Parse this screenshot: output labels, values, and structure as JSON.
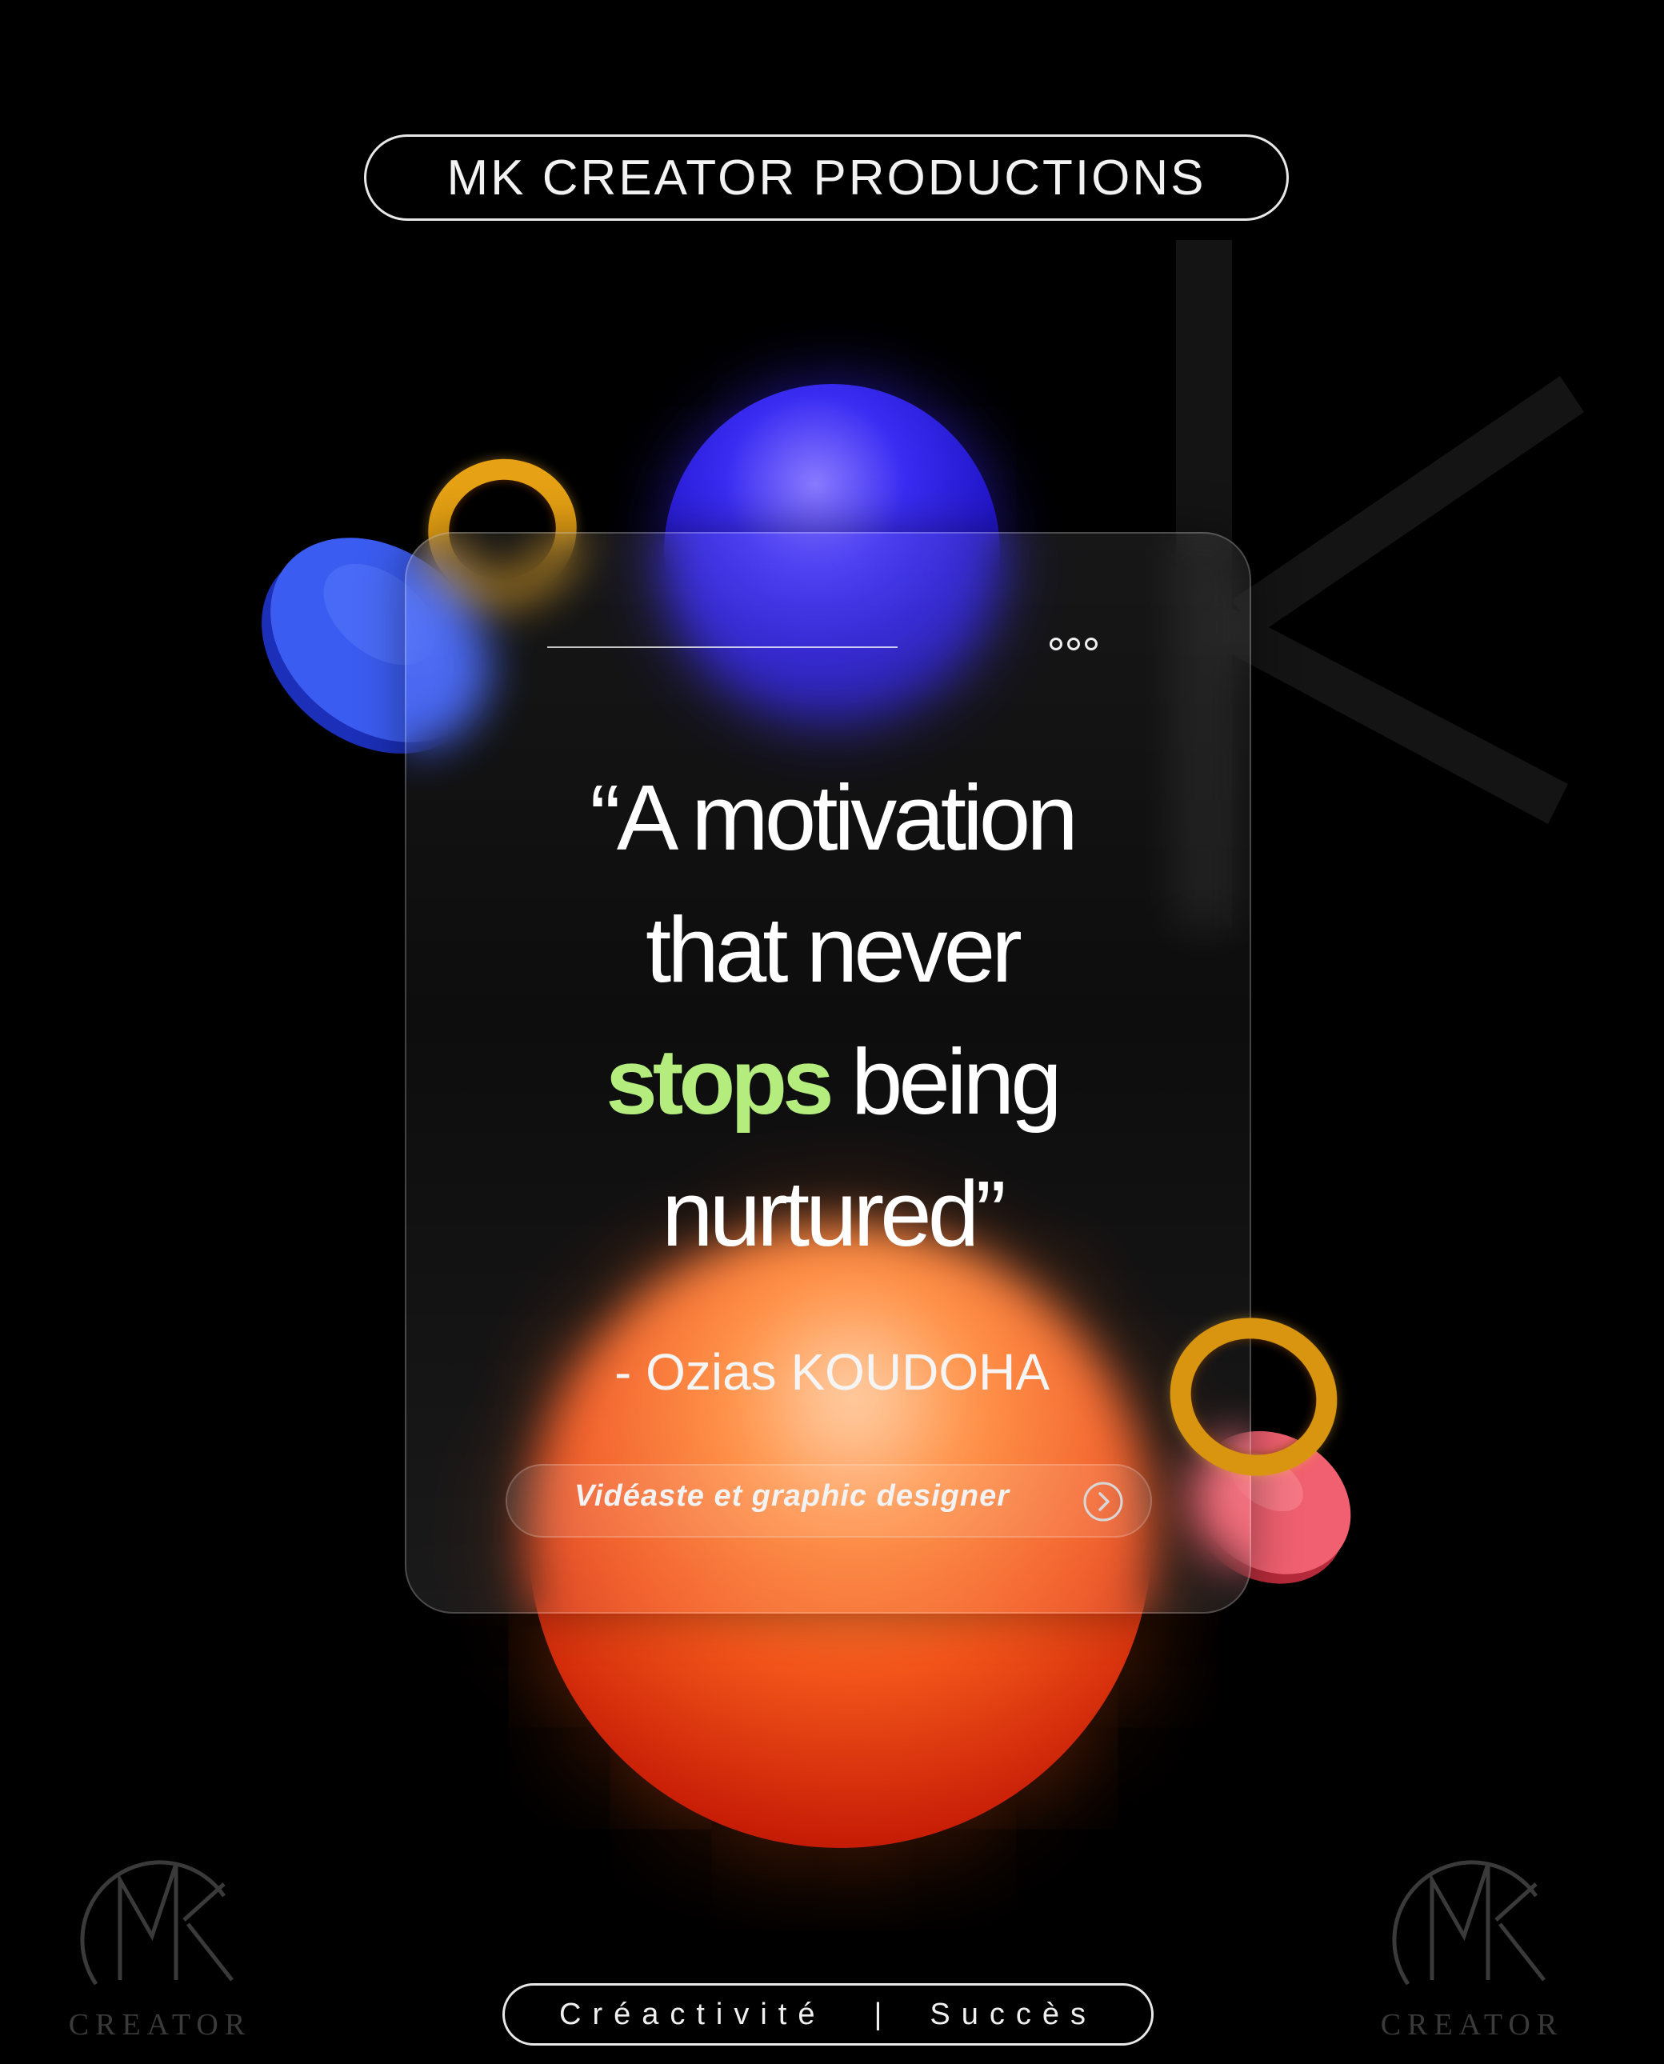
{
  "header": {
    "title": "MK CREATOR PRODUCTIONS"
  },
  "card": {
    "quote": {
      "line1": "“A motivation",
      "line2": "that never",
      "highlight": "stops",
      "line3_rest": " being",
      "line4": "nurtured”"
    },
    "author": "- Ozias KOUDOHA",
    "role": "Vidéaste et graphic designer",
    "menu_icon": "more-dots-icon",
    "arrow_icon": "chevron-right-circle-icon"
  },
  "footer": {
    "left": "Créactivité",
    "separator": "|",
    "right": "Succès"
  },
  "logo": {
    "text": "CREATOR"
  },
  "colors": {
    "background": "#000000",
    "accent_green": "#b4ec7e",
    "orb_blue": "#2a1ee0",
    "orb_orange": "#f2541a",
    "ring_gold": "#e6a114",
    "coin_red": "#f06070"
  }
}
